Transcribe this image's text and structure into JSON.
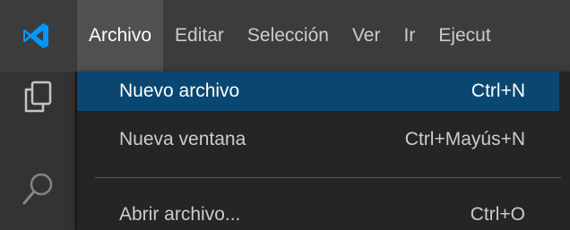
{
  "menubar": {
    "logo_icon": "vscode-logo-icon",
    "items": [
      {
        "label": "Archivo"
      },
      {
        "label": "Editar"
      },
      {
        "label": "Selección"
      },
      {
        "label": "Ver"
      },
      {
        "label": "Ir"
      },
      {
        "label": "Ejecut"
      }
    ]
  },
  "activitybar": {
    "icons": [
      "explorer-icon",
      "search-icon"
    ]
  },
  "file_menu": {
    "items": [
      {
        "label": "Nuevo archivo",
        "shortcut": "Ctrl+N"
      },
      {
        "label": "Nueva ventana",
        "shortcut": "Ctrl+Mayús+N"
      },
      {
        "label": "Abrir archivo...",
        "shortcut": "Ctrl+O"
      }
    ]
  },
  "colors": {
    "menubar_bg": "#3c3c3c",
    "active_menu_bg": "#505050",
    "activitybar_bg": "#333333",
    "dropdown_bg": "#252526",
    "selection_bg": "#094771",
    "vscode_blue": "#0098ff"
  }
}
